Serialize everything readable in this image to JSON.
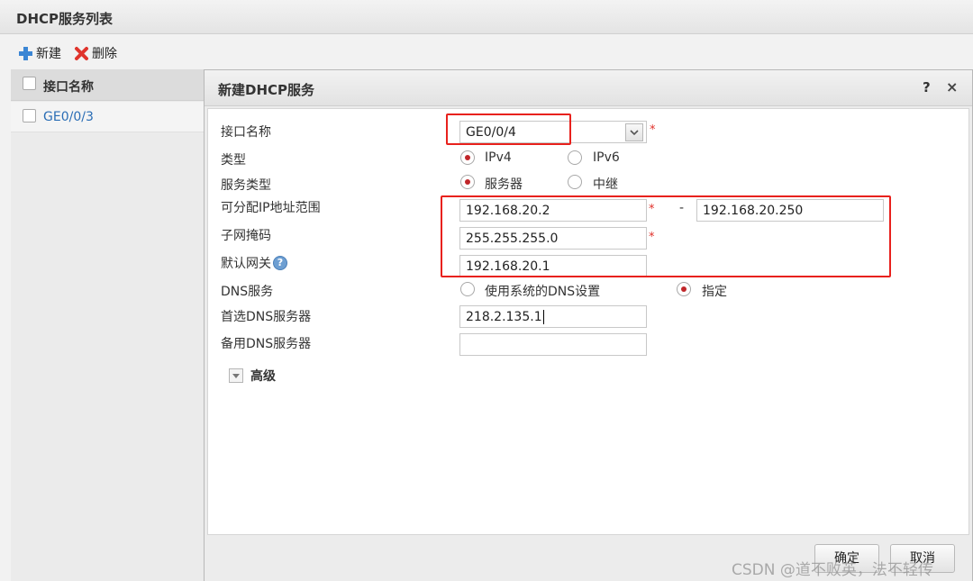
{
  "panel": {
    "title": "DHCP服务列表"
  },
  "toolbar": {
    "new_label": "新建",
    "delete_label": "删除"
  },
  "list": {
    "header_label": "接口名称",
    "rows": [
      {
        "label": "GE0/0/3"
      }
    ]
  },
  "dialog": {
    "title": "新建DHCP服务",
    "help_label": "?",
    "close_label": "×",
    "required_mark": "*",
    "interface": {
      "label": "接口名称",
      "value": "GE0/0/4"
    },
    "type": {
      "label": "类型",
      "options": [
        "IPv4",
        "IPv6"
      ],
      "selected": "IPv4"
    },
    "service_type": {
      "label": "服务类型",
      "options": [
        "服务器",
        "中继"
      ],
      "selected": "服务器"
    },
    "ip_range": {
      "label": "可分配IP地址范围",
      "start": "192.168.20.2",
      "separator": "-",
      "end": "192.168.20.250"
    },
    "subnet_mask": {
      "label": "子网掩码",
      "value": "255.255.255.0"
    },
    "gateway": {
      "label": "默认网关",
      "value": "192.168.20.1",
      "help": "?"
    },
    "dns_service": {
      "label": "DNS服务",
      "options": [
        "使用系统的DNS设置",
        "指定"
      ],
      "selected": "指定"
    },
    "primary_dns": {
      "label": "首选DNS服务器",
      "value": "218.2.135.1"
    },
    "secondary_dns": {
      "label": "备用DNS服务器",
      "value": ""
    },
    "advanced": {
      "label": "高级"
    },
    "buttons": {
      "ok": "确定",
      "cancel": "取消"
    }
  },
  "watermark": "CSDN @道不败英，法不轻传",
  "colors": {
    "accent_red": "#e8211d",
    "radio_dot": "#c0262a",
    "link_blue": "#2a6db5"
  },
  "icons": {
    "new": "plus-icon",
    "delete": "delete-x-icon",
    "help": "question-icon",
    "advanced": "chevron-down-icon"
  }
}
